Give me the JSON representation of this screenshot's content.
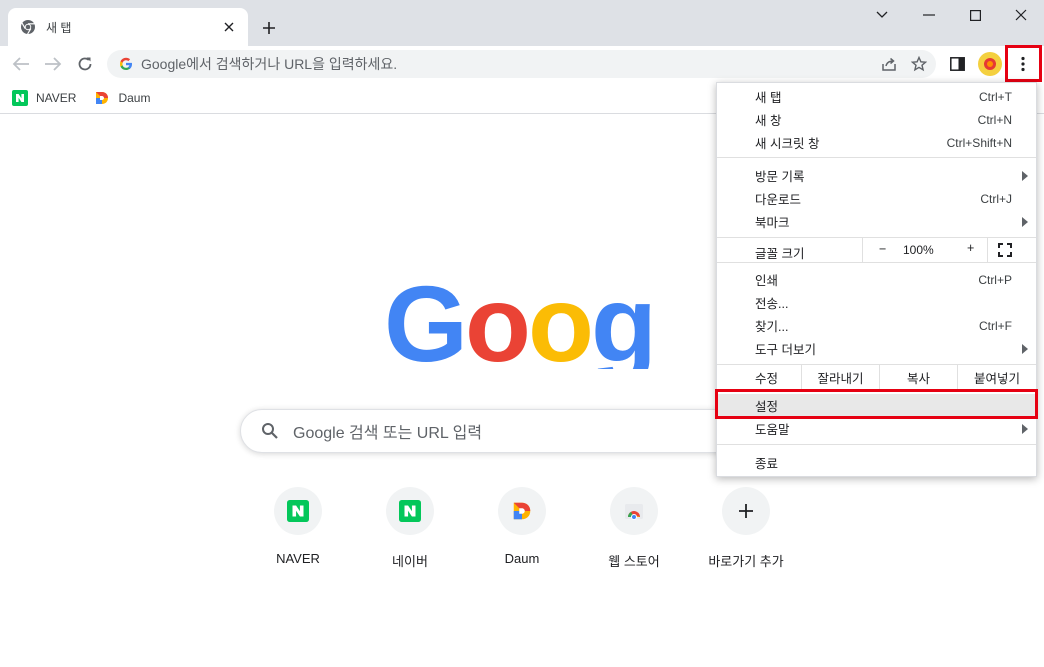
{
  "tab": {
    "title": "새 탭"
  },
  "omnibox": {
    "placeholder": "Google에서 검색하거나 URL을 입력하세요."
  },
  "bookmarks": [
    {
      "label": "NAVER"
    },
    {
      "label": "Daum"
    }
  ],
  "ntp": {
    "search_placeholder": "Google 검색 또는 URL 입력",
    "shortcuts": [
      {
        "label": "NAVER",
        "icon": "naver-icon"
      },
      {
        "label": "네이버",
        "icon": "naver-icon"
      },
      {
        "label": "Daum",
        "icon": "daum-icon"
      },
      {
        "label": "웹 스토어",
        "icon": "chrome-webstore-icon"
      },
      {
        "label": "바로가기 추가",
        "icon": "plus-icon"
      }
    ]
  },
  "menu": {
    "new_tab": {
      "label": "새 탭",
      "shortcut": "Ctrl+T"
    },
    "new_window": {
      "label": "새 창",
      "shortcut": "Ctrl+N"
    },
    "incognito": {
      "label": "새 시크릿 창",
      "shortcut": "Ctrl+Shift+N"
    },
    "history": {
      "label": "방문 기록"
    },
    "downloads": {
      "label": "다운로드",
      "shortcut": "Ctrl+J"
    },
    "bookmarks": {
      "label": "북마크"
    },
    "zoom": {
      "label": "글꼴 크기",
      "minus": "−",
      "value": "100%",
      "plus": "+"
    },
    "print": {
      "label": "인쇄",
      "shortcut": "Ctrl+P"
    },
    "cast": {
      "label": "전송..."
    },
    "find": {
      "label": "찾기...",
      "shortcut": "Ctrl+F"
    },
    "more_tools": {
      "label": "도구 더보기"
    },
    "edit": {
      "label": "수정",
      "cut": "잘라내기",
      "copy": "복사",
      "paste": "붙여넣기"
    },
    "settings": {
      "label": "설정"
    },
    "help": {
      "label": "도움말"
    },
    "exit": {
      "label": "종료"
    }
  },
  "colors": {
    "highlight": "#e60012",
    "google_blue": "#4285f4",
    "google_red": "#ea4335",
    "google_yellow": "#fbbc05",
    "google_green": "#34a853",
    "naver_green": "#03c75a"
  }
}
